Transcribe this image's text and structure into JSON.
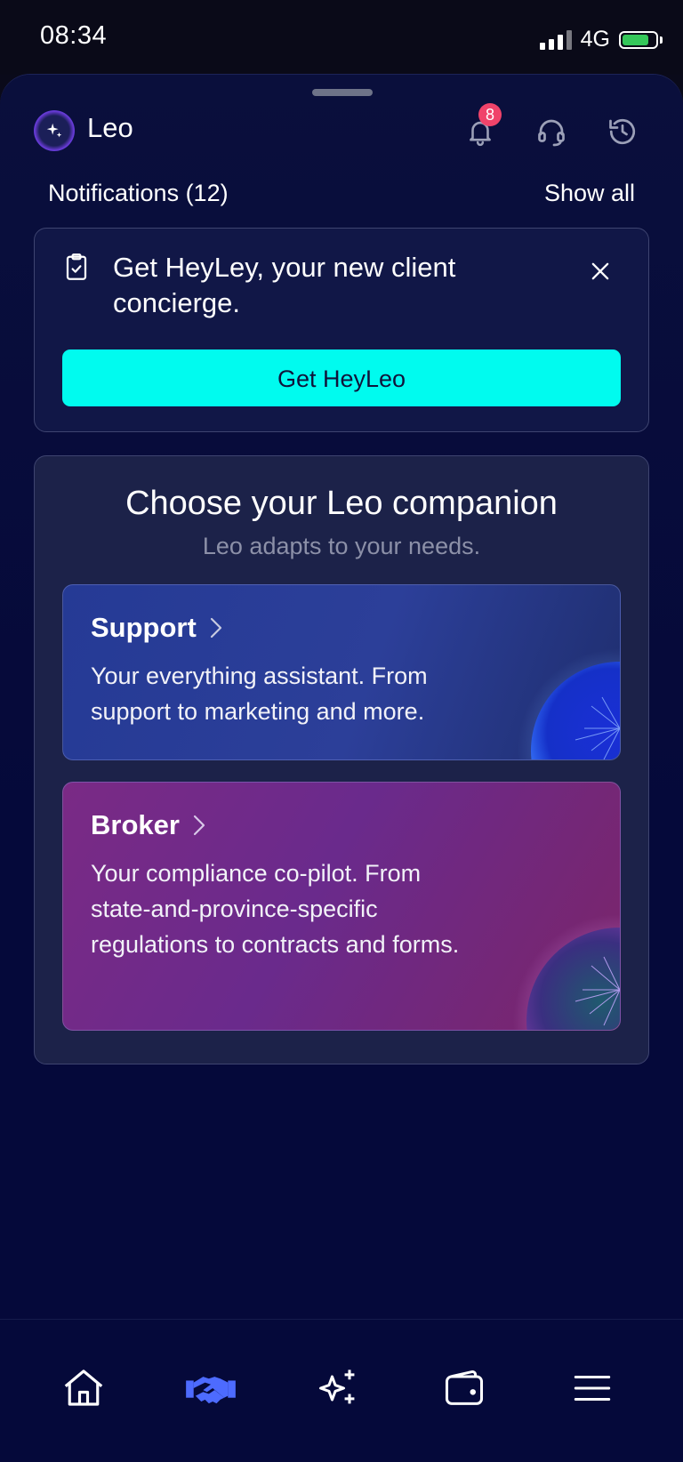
{
  "status": {
    "time": "08:34",
    "network": "4G",
    "battery_level": 0.85
  },
  "header": {
    "app_name": "Leo",
    "notification_count": "8"
  },
  "notifications": {
    "title": "Notifications (12)",
    "show_all": "Show all",
    "card": {
      "text": "Get HeyLey, your new client concierge.",
      "cta": "Get HeyLeo"
    }
  },
  "companion": {
    "title": "Choose your Leo companion",
    "subtitle": "Leo adapts to your needs.",
    "options": [
      {
        "title": "Support",
        "description": "Your everything assistant. From support to marketing and more."
      },
      {
        "title": "Broker",
        "description": "Your compliance co-pilot. From state-and-province-specific regulations to contracts and forms."
      }
    ]
  },
  "tabbar": {
    "icons": [
      "home-icon",
      "handshake-icon",
      "sparkles-icon",
      "wallet-icon",
      "menu-icon"
    ],
    "active_color": "#4d6bff"
  },
  "colors": {
    "accent": "#00fbef",
    "badge": "#f0436a",
    "background": "#05093a"
  }
}
